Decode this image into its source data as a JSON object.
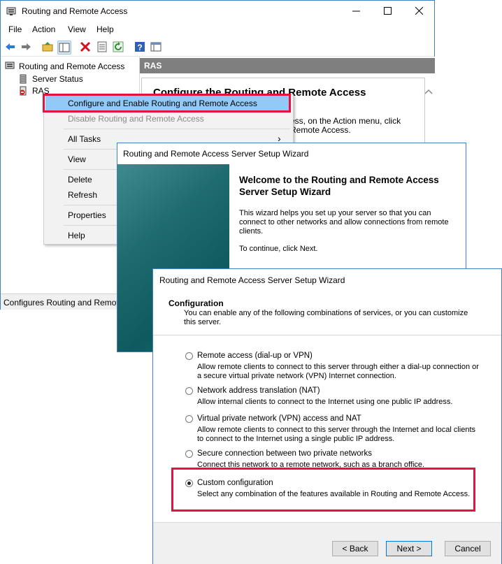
{
  "mmc": {
    "title": "Routing and Remote Access",
    "menu": [
      "File",
      "Action",
      "View",
      "Help"
    ],
    "toolbar_icons": [
      "back-arrow-icon",
      "forward-arrow-icon",
      "up-folder-icon",
      "show-hide-tree-icon",
      "delete-icon",
      "properties-icon",
      "refresh-icon",
      "help-icon",
      "console-icon"
    ],
    "tree": {
      "root": "Routing and Remote Access",
      "items": [
        "Server Status",
        "RAS"
      ]
    },
    "pane_header": "RAS",
    "panel_title": "Configure the Routing and Remote Access",
    "panel_text_1": "ess, on the Action menu, click",
    "panel_text_2": "Remote Access.",
    "status_text": "Configures Routing and Remote Access"
  },
  "context_menu": {
    "items": [
      {
        "label": "Configure and Enable Routing and Remote Access",
        "enabled": true,
        "selected": true
      },
      {
        "label": "Disable Routing and Remote Access",
        "enabled": false
      },
      {
        "label": "All Tasks",
        "enabled": true,
        "submenu": true
      },
      {
        "label": "View",
        "enabled": true
      },
      {
        "label": "Delete",
        "enabled": true
      },
      {
        "label": "Refresh",
        "enabled": true
      },
      {
        "label": "Properties",
        "enabled": true
      },
      {
        "label": "Help",
        "enabled": true
      }
    ],
    "submenu_arrow": "›"
  },
  "wizard_welcome": {
    "title": "Routing and Remote Access Server Setup Wizard",
    "heading": "Welcome to the Routing and Remote Access Server Setup Wizard",
    "body": "This wizard helps you set up your server so that you can connect to other networks and allow connections from remote clients.",
    "continue": "To continue, click Next."
  },
  "wizard_config": {
    "title": "Routing and Remote Access Server Setup Wizard",
    "heading": "Configuration",
    "description": "You can enable any of the following combinations of services, or you can customize this server.",
    "options": [
      {
        "label": "Remote access (dial-up or VPN)",
        "desc": "Allow remote clients to connect to this server through either a dial-up connection or a secure virtual private network (VPN) Internet connection.",
        "selected": false
      },
      {
        "label": "Network address translation (NAT)",
        "desc": "Allow internal clients to connect to the Internet using one public IP address.",
        "selected": false
      },
      {
        "label": "Virtual private network (VPN) access and NAT",
        "desc": "Allow remote clients to connect to this server through the Internet and local clients to connect to the Internet using a single public IP address.",
        "selected": false
      },
      {
        "label": "Secure connection between two private networks",
        "desc": "Connect this network to a remote network, such as a branch office.",
        "selected": false
      },
      {
        "label": "Custom configuration",
        "desc": "Select any combination of the features available in Routing and Remote Access.",
        "selected": true
      }
    ],
    "buttons": {
      "back": "< Back",
      "next": "Next >",
      "cancel": "Cancel"
    }
  },
  "colors": {
    "highlight_border": "#e3123f",
    "menu_selected": "#91c9f7",
    "window_border": "#3f7fc3"
  }
}
